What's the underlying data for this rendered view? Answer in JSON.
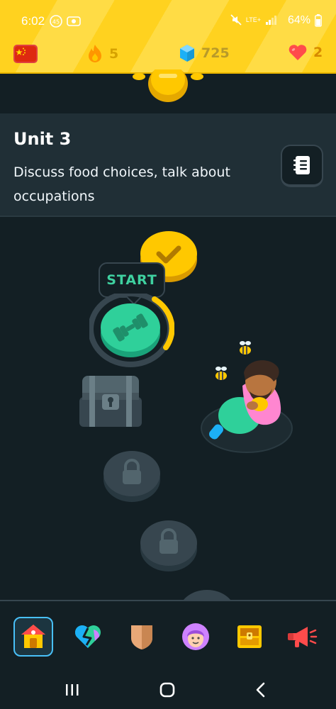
{
  "status_bar": {
    "time": "6:02",
    "battery": "64%",
    "network": "LTE+"
  },
  "stats": {
    "language_flag": "china-flag-icon",
    "streak": "5",
    "gems": "725",
    "hearts": "2"
  },
  "unit": {
    "title": "Unit 3",
    "description": "Discuss food choices, talk about occupations"
  },
  "path": {
    "start_label": "START"
  },
  "colors": {
    "header_yellow": "#ffd21f",
    "background": "#131f24",
    "banner": "#202f36",
    "node_active": "#2fd09a",
    "progress_ring": "#ffc800",
    "locked_node": "#37464f",
    "nav_active_border": "#49c0f8"
  },
  "bottom_nav": {
    "items": [
      {
        "icon": "home-icon",
        "active": true
      },
      {
        "icon": "practice-heart-icon",
        "active": false
      },
      {
        "icon": "leaderboard-shield-icon",
        "active": false
      },
      {
        "icon": "profile-icon",
        "active": false
      },
      {
        "icon": "quests-chest-icon",
        "active": false
      },
      {
        "icon": "news-megaphone-icon",
        "active": false
      }
    ]
  },
  "system_nav": [
    "recents-icon",
    "home-button-icon",
    "back-icon"
  ]
}
